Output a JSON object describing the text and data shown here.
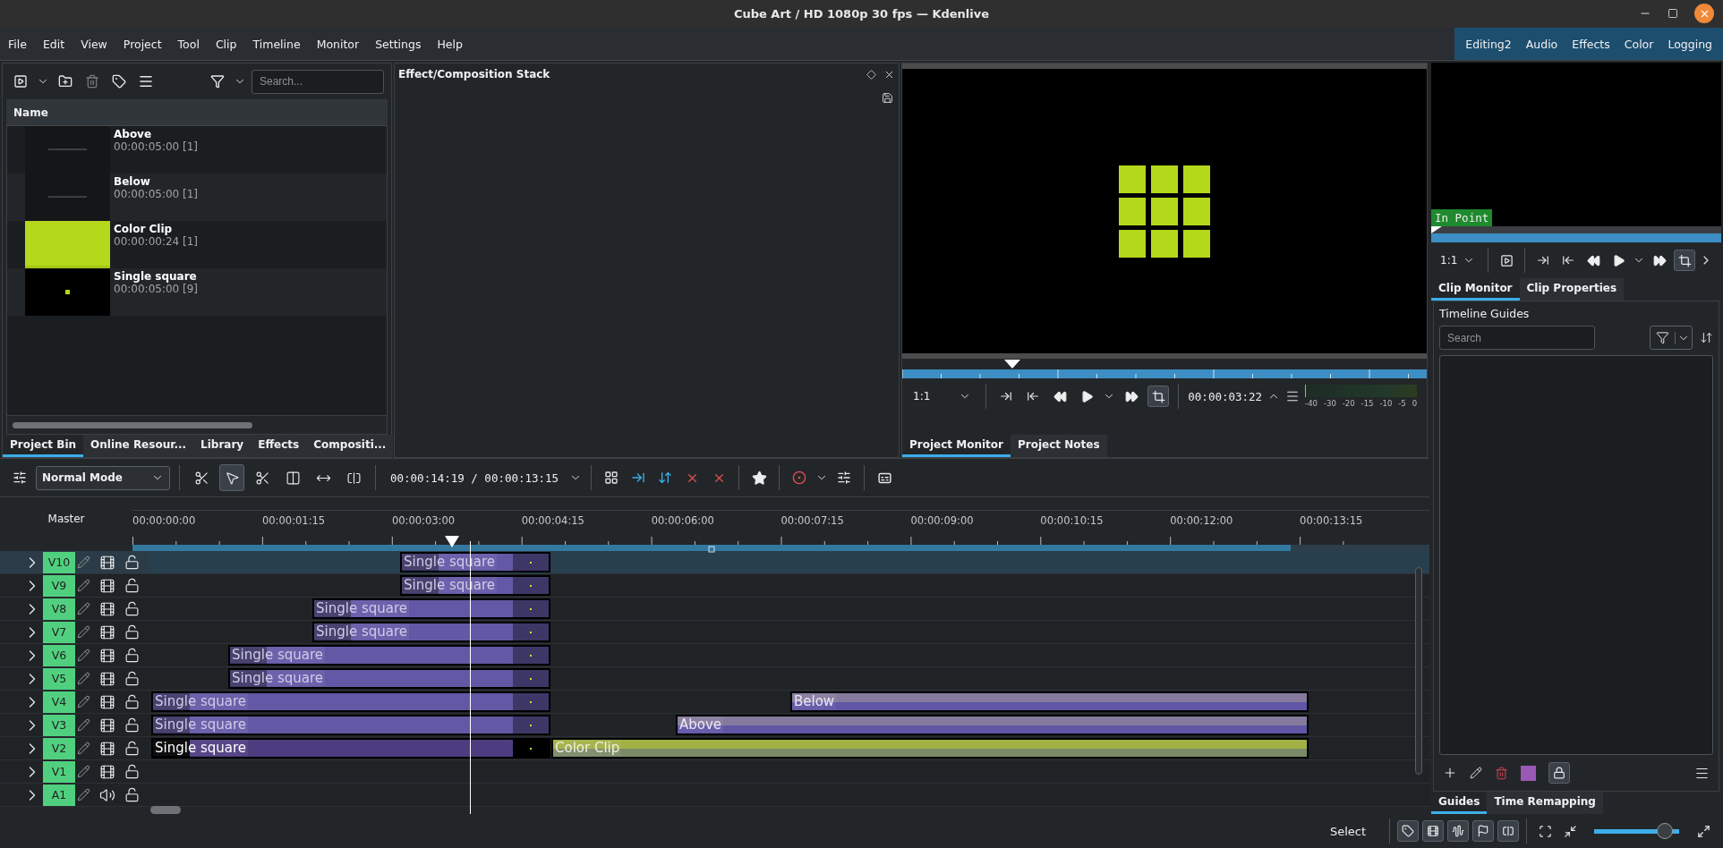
{
  "window": {
    "title": "Cube Art / HD 1080p 30 fps — Kdenlive"
  },
  "menu": [
    "File",
    "Edit",
    "View",
    "Project",
    "Tool",
    "Clip",
    "Timeline",
    "Monitor",
    "Settings",
    "Help"
  ],
  "workspaces": [
    {
      "label": "Editing2"
    },
    {
      "label": "Audio"
    },
    {
      "label": "Effects"
    },
    {
      "label": "Color"
    },
    {
      "label": "Logging"
    }
  ],
  "project_bin": {
    "search": {
      "placeholder": "Search..."
    },
    "column": "Name",
    "items": [
      {
        "name": "Above",
        "duration": "00:00:05:00 [1]",
        "kind": "title"
      },
      {
        "name": "Below",
        "duration": "00:00:05:00 [1]",
        "kind": "title"
      },
      {
        "name": "Color Clip",
        "duration": "00:00:00:24 [1]",
        "kind": "color"
      },
      {
        "name": "Single square",
        "duration": "00:00:05:00 [9]",
        "kind": "square"
      }
    ],
    "tabs": [
      {
        "label": "Project Bin",
        "selected": true
      },
      {
        "label": "Online Resour...",
        "selected": false
      },
      {
        "label": "Library",
        "selected": false
      },
      {
        "label": "Effects",
        "selected": false
      },
      {
        "label": "Compositi...",
        "selected": false
      }
    ]
  },
  "effect_stack": {
    "title": "Effect/Composition Stack"
  },
  "project_monitor": {
    "zoom": "1:1",
    "timecode": "00:00:03:22",
    "meter_labels": [
      "-40",
      "-30",
      "-20",
      "-15",
      "-10",
      "-5",
      "0"
    ],
    "tabs": [
      {
        "label": "Project Monitor",
        "selected": true
      },
      {
        "label": "Project Notes",
        "selected": false
      }
    ]
  },
  "clip_monitor": {
    "overlay": "In Point",
    "zoom": "1:1",
    "tabs": [
      {
        "label": "Clip Monitor",
        "selected": true
      },
      {
        "label": "Clip Properties",
        "selected": false
      }
    ]
  },
  "guides": {
    "title": "Timeline Guides",
    "search": {
      "placeholder": "Search"
    },
    "tabs": [
      {
        "label": "Guides",
        "selected": true
      },
      {
        "label": "Time Remapping",
        "selected": false
      }
    ]
  },
  "timeline_toolbar": {
    "mode": "Normal Mode",
    "timecode": "00:00:14:19 / 00:00:13:15",
    "tools": [
      {
        "kind": "razor-snap",
        "selected": false
      },
      {
        "kind": "select",
        "selected": true
      },
      {
        "kind": "cut",
        "selected": false
      },
      {
        "kind": "spacer",
        "selected": false
      },
      {
        "kind": "ripple",
        "selected": false
      },
      {
        "kind": "slip",
        "selected": false
      }
    ]
  },
  "timeline": {
    "master": "Master",
    "ruler": [
      "00:00:00:00",
      "00:00:01:15",
      "00:00:03:00",
      "00:00:04:15",
      "00:00:06:00",
      "00:00:07:15",
      "00:00:09:00",
      "00:00:10:15",
      "00:00:12:00",
      "00:00:13:15"
    ],
    "tracks": [
      {
        "name": "V10",
        "kind": "video",
        "selected": true,
        "clips": [
          {
            "name": "Single square",
            "kind": "video",
            "selected": false
          }
        ]
      },
      {
        "name": "V9",
        "kind": "video",
        "selected": false,
        "clips": [
          {
            "name": "Single square",
            "kind": "video",
            "selected": false
          }
        ]
      },
      {
        "name": "V8",
        "kind": "video",
        "selected": false,
        "clips": [
          {
            "name": "Single square",
            "kind": "video",
            "selected": false
          }
        ]
      },
      {
        "name": "V7",
        "kind": "video",
        "selected": false,
        "clips": [
          {
            "name": "Single square",
            "kind": "video",
            "selected": false
          }
        ]
      },
      {
        "name": "V6",
        "kind": "video",
        "selected": false,
        "clips": [
          {
            "name": "Single square",
            "kind": "video",
            "selected": false
          }
        ]
      },
      {
        "name": "V5",
        "kind": "video",
        "selected": false,
        "clips": [
          {
            "name": "Single square",
            "kind": "video",
            "selected": false
          }
        ]
      },
      {
        "name": "V4",
        "kind": "video",
        "selected": false,
        "clips": [
          {
            "name": "Single square",
            "kind": "video",
            "selected": false
          },
          {
            "name": "Below",
            "kind": "title",
            "selected": false
          }
        ]
      },
      {
        "name": "V3",
        "kind": "video",
        "selected": false,
        "clips": [
          {
            "name": "Single square",
            "kind": "video",
            "selected": false
          },
          {
            "name": "Above",
            "kind": "title",
            "selected": false
          }
        ]
      },
      {
        "name": "V2",
        "kind": "video",
        "selected": false,
        "clips": [
          {
            "name": "Single square",
            "kind": "video",
            "selected": true
          },
          {
            "name": "Color Clip",
            "kind": "color",
            "selected": false
          }
        ]
      },
      {
        "name": "V1",
        "kind": "video",
        "selected": false
      },
      {
        "name": "A1",
        "kind": "audio",
        "selected": false
      }
    ]
  },
  "status_bar": {
    "mode": "Select",
    "zoom": {
      "level": 0.8
    }
  }
}
